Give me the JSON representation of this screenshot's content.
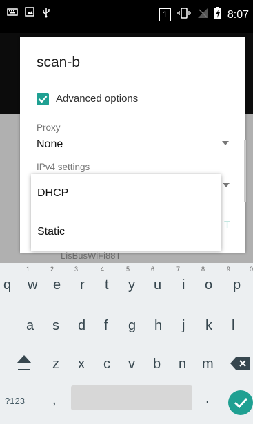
{
  "status_bar": {
    "time": "8:07",
    "sim_slot": "1",
    "icons": [
      "keyboard-icon",
      "image-icon",
      "usb-icon",
      "sim-icon",
      "vibrate-icon",
      "no-signal-icon",
      "battery-charging-icon"
    ]
  },
  "dialog": {
    "title": "scan-b",
    "advanced_options_label": "Advanced options",
    "advanced_options_checked": true,
    "proxy_label": "Proxy",
    "proxy_value": "None",
    "ipv4_label": "IPv4 settings"
  },
  "popup": {
    "options": [
      "DHCP",
      "Static"
    ]
  },
  "background": {
    "partial_text": "LisBusWiFi88T",
    "faded_button_fragment": "T"
  },
  "keyboard": {
    "row1": [
      {
        "key": "q",
        "hint": "1"
      },
      {
        "key": "w",
        "hint": "2"
      },
      {
        "key": "e",
        "hint": "3"
      },
      {
        "key": "r",
        "hint": "4"
      },
      {
        "key": "t",
        "hint": "5"
      },
      {
        "key": "y",
        "hint": "6"
      },
      {
        "key": "u",
        "hint": "7"
      },
      {
        "key": "i",
        "hint": "8"
      },
      {
        "key": "o",
        "hint": "9"
      },
      {
        "key": "p",
        "hint": "0"
      }
    ],
    "row2": [
      "a",
      "s",
      "d",
      "f",
      "g",
      "h",
      "j",
      "k",
      "l"
    ],
    "row3": [
      "z",
      "x",
      "c",
      "v",
      "b",
      "n",
      "m"
    ],
    "symbols_label": "?123",
    "comma": ",",
    "period": "."
  },
  "colors": {
    "accent": "#1fa092",
    "status_bar": "#000000",
    "keyboard_bg": "#eceff1"
  }
}
